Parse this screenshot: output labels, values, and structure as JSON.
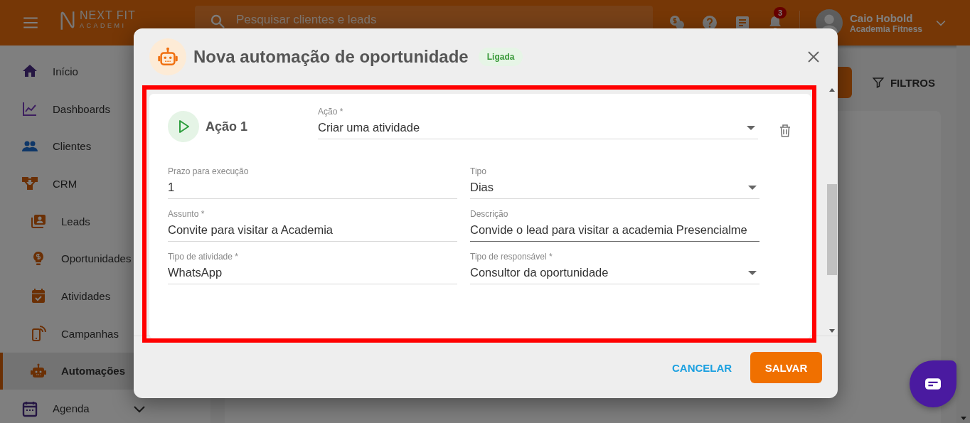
{
  "header": {
    "logo": {
      "title": "NEXT FIT",
      "subtitle": "ACADEMI"
    },
    "search": {
      "placeholder": "Pesquisar clientes e leads"
    },
    "notifications_badge": "3",
    "user": {
      "name": "Caio Hobold",
      "company": "Academia Fitness"
    }
  },
  "sidebar": {
    "items": [
      {
        "label": "Início",
        "selected": false
      },
      {
        "label": "Dashboards",
        "selected": false
      },
      {
        "label": "Clientes",
        "selected": false
      },
      {
        "label": "CRM",
        "selected": false,
        "children": [
          {
            "label": "Leads",
            "selected": false
          },
          {
            "label": "Oportunidades",
            "selected": false
          },
          {
            "label": "Atividades",
            "selected": false
          },
          {
            "label": "Campanhas",
            "selected": false
          },
          {
            "label": "Automações",
            "selected": true
          }
        ]
      },
      {
        "label": "Agenda",
        "selected": false,
        "expanded": false
      }
    ]
  },
  "toolbar": {
    "filters_button": "FILTROS"
  },
  "dialog": {
    "title": "Nova automação de oportunidade",
    "status": {
      "label": "Ligada",
      "on": true
    },
    "actions": [
      {
        "title": "Ação 1",
        "action_field": {
          "label": "Ação *",
          "value": "Criar uma atividade",
          "kind": "select"
        },
        "fields": [
          {
            "label": "Prazo para execução",
            "value": "1",
            "kind": "text",
            "focused": false
          },
          {
            "label": "Tipo",
            "value": "Dias",
            "kind": "select",
            "focused": false
          },
          {
            "label": "Assunto *",
            "value": "Convite para visitar a Academia",
            "kind": "text",
            "focused": false
          },
          {
            "label": "Descrição",
            "value": "Convide o lead para visitar a academia Presencialme",
            "kind": "text",
            "focused": true
          },
          {
            "label": "Tipo de atividade *",
            "value": "WhatsApp",
            "kind": "text",
            "focused": false
          },
          {
            "label": "Tipo de responsável *",
            "value": "Consultor da oportunidade",
            "kind": "select",
            "focused": false
          }
        ]
      }
    ],
    "buttons": [
      {
        "label": "CANCELAR",
        "kind": "text"
      },
      {
        "label": "SALVAR",
        "kind": "primary"
      }
    ]
  }
}
